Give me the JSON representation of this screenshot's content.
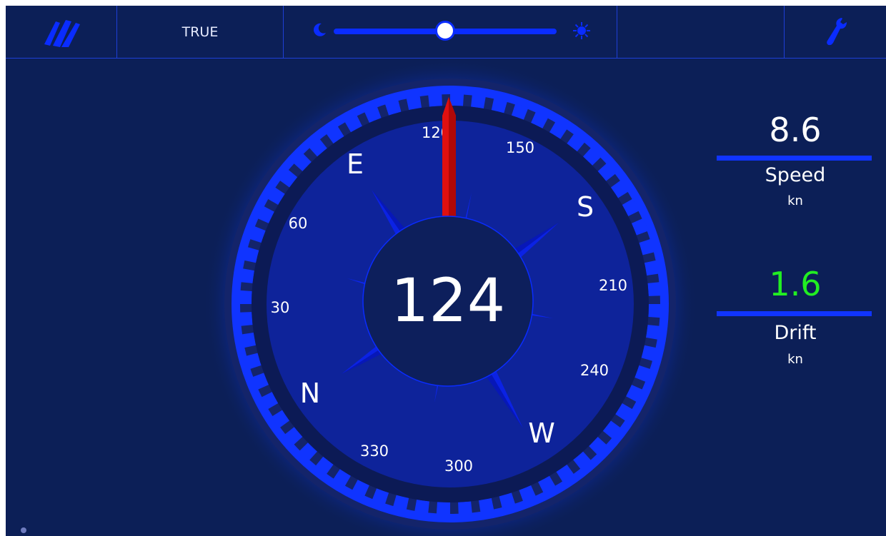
{
  "topbar": {
    "logo_icon": "boat-trails-icon",
    "mode_label": "TRUE",
    "brightness": {
      "night_icon": "moon-icon",
      "day_icon": "sun-icon",
      "level_fraction": 0.5
    },
    "settings_icon": "wrench-icon"
  },
  "compass": {
    "heading": "124",
    "pointer_icon": "heading-needle",
    "cardinals": [
      "E",
      "S",
      "W",
      "N"
    ],
    "degree_labels": [
      "120",
      "150",
      "210",
      "240",
      "300",
      "330",
      "30",
      "60"
    ]
  },
  "speed": {
    "value": "8.6",
    "label": "Speed",
    "unit": "kn"
  },
  "drift": {
    "value": "1.6",
    "label": "Drift",
    "unit": "kn"
  },
  "colors": {
    "background": "#0c1f57",
    "accent": "#0a2cff",
    "needle": "#e01010",
    "drift_value": "#22ee22",
    "text": "#ffffff"
  }
}
